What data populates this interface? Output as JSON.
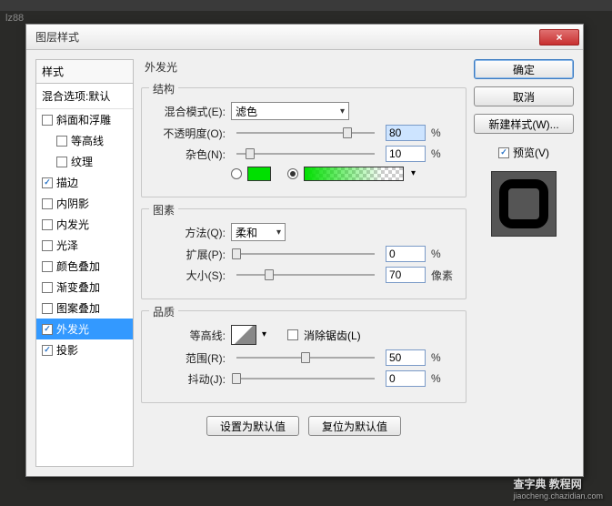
{
  "bgTag": "lz88",
  "dialog": {
    "title": "图层样式",
    "close": "×"
  },
  "styles": {
    "header": "样式",
    "blendDefault": "混合选项:默认",
    "items": [
      {
        "label": "斜面和浮雕",
        "checked": false,
        "indent": false
      },
      {
        "label": "等高线",
        "checked": false,
        "indent": true
      },
      {
        "label": "纹理",
        "checked": false,
        "indent": true
      },
      {
        "label": "描边",
        "checked": true,
        "indent": false
      },
      {
        "label": "内阴影",
        "checked": false,
        "indent": false
      },
      {
        "label": "内发光",
        "checked": false,
        "indent": false
      },
      {
        "label": "光泽",
        "checked": false,
        "indent": false
      },
      {
        "label": "颜色叠加",
        "checked": false,
        "indent": false
      },
      {
        "label": "渐变叠加",
        "checked": false,
        "indent": false
      },
      {
        "label": "图案叠加",
        "checked": false,
        "indent": false
      },
      {
        "label": "外发光",
        "checked": true,
        "indent": false,
        "selected": true
      },
      {
        "label": "投影",
        "checked": true,
        "indent": false
      }
    ]
  },
  "panel": {
    "title": "外发光",
    "struct": {
      "title": "结构",
      "blendMode": {
        "label": "混合模式(E):",
        "value": "滤色"
      },
      "opacity": {
        "label": "不透明度(O):",
        "value": "80",
        "unit": "%",
        "pos": 80
      },
      "noise": {
        "label": "杂色(N):",
        "value": "10",
        "unit": "%",
        "pos": 10
      },
      "colorSolid": "#00e000",
      "gradient": "green-transparent"
    },
    "elements": {
      "title": "图素",
      "technique": {
        "label": "方法(Q):",
        "value": "柔和"
      },
      "spread": {
        "label": "扩展(P):",
        "value": "0",
        "unit": "%",
        "pos": 0
      },
      "size": {
        "label": "大小(S):",
        "value": "70",
        "unit": "像素",
        "pos": 24
      }
    },
    "quality": {
      "title": "品质",
      "contour": {
        "label": "等高线:"
      },
      "antiAlias": {
        "label": "消除锯齿(L)",
        "checked": false
      },
      "range": {
        "label": "范围(R):",
        "value": "50",
        "unit": "%",
        "pos": 50
      },
      "jitter": {
        "label": "抖动(J):",
        "value": "0",
        "unit": "%",
        "pos": 0
      }
    },
    "footer": {
      "setDefault": "设置为默认值",
      "reset": "复位为默认值"
    }
  },
  "buttons": {
    "ok": "确定",
    "cancel": "取消",
    "newStyle": "新建样式(W)...",
    "preview": "预览(V)"
  },
  "watermark": {
    "main": "查字典 教程网",
    "sub": "jiaocheng.chazidian.com"
  }
}
